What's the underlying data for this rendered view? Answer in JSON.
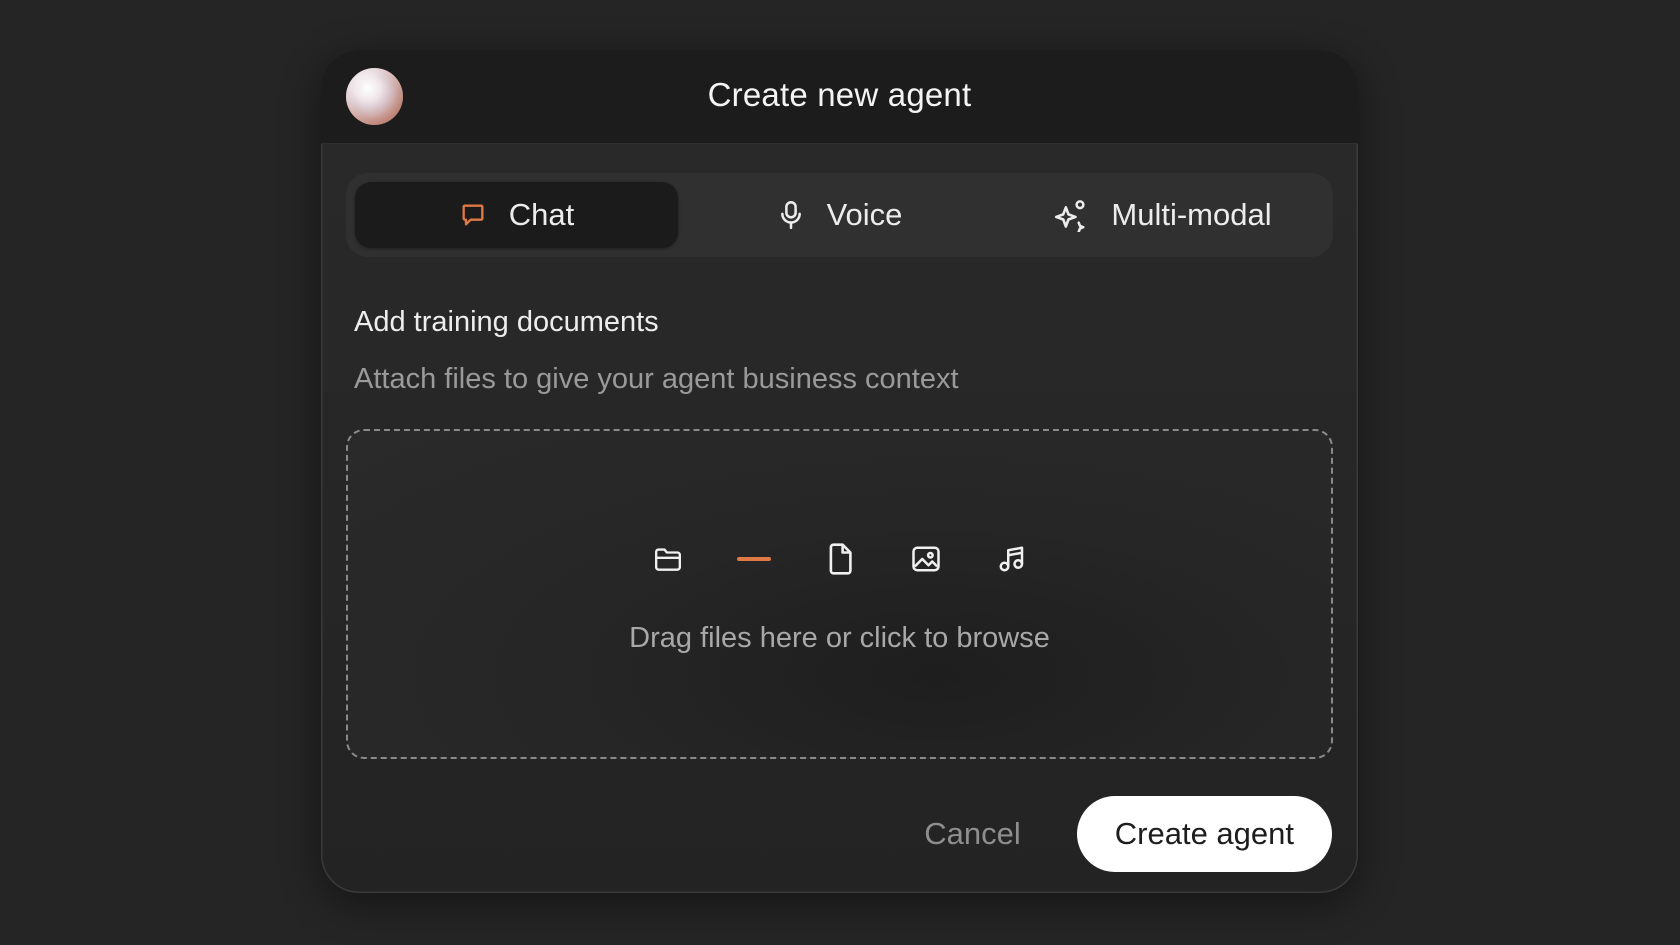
{
  "dialog": {
    "title": "Create new agent"
  },
  "tabs": [
    {
      "label": "Chat",
      "icon": "chat-bubble-icon",
      "active": true
    },
    {
      "label": "Voice",
      "icon": "microphone-icon",
      "active": false
    },
    {
      "label": "Multi-modal",
      "icon": "sparkles-icon",
      "active": false
    }
  ],
  "section": {
    "title": "Add training documents",
    "subtitle": "Attach files to give your agent business context"
  },
  "dropzone": {
    "text": "Drag files here or click to browse",
    "icons": [
      "folder-icon",
      "dash-icon",
      "document-icon",
      "image-icon",
      "music-note-icon"
    ]
  },
  "footer": {
    "cancel_label": "Cancel",
    "create_label": "Create agent"
  },
  "colors": {
    "accent": "#e07a45",
    "background": "#252525",
    "header": "#1c1c1c",
    "primary_button": "#ffffff"
  }
}
